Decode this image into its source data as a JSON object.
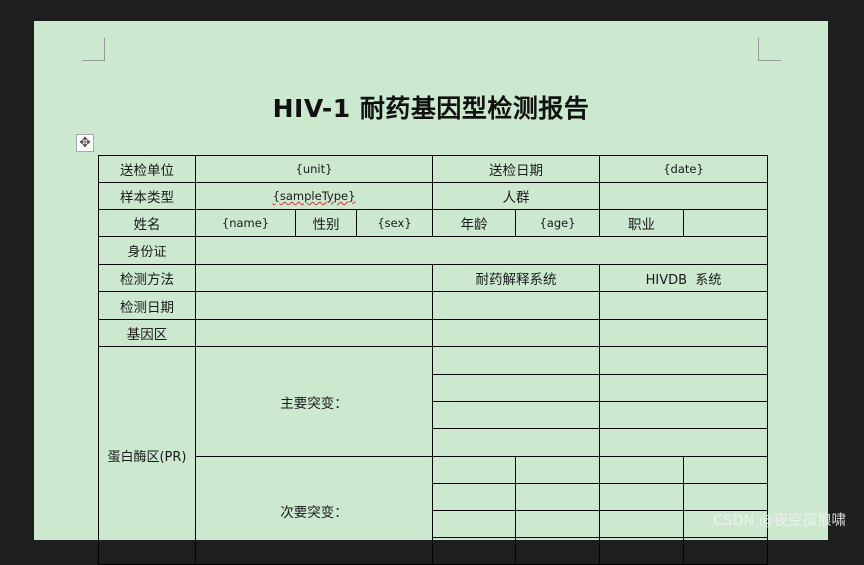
{
  "title": "HIV-1 耐药基因型检测报告",
  "row1": {
    "unit_label": "送检单位",
    "unit_value": "{unit}",
    "date_label": "送检日期",
    "date_value": "{date}"
  },
  "row2": {
    "sample_label": "样本类型",
    "sample_value": "{sampleType}",
    "crowd_label": "人群"
  },
  "row3": {
    "name_label": "姓名",
    "name_value": "{name}",
    "sex_label": "性别",
    "sex_value": "{sex}",
    "age_label": "年龄",
    "age_value": "{age}",
    "job_label": "职业"
  },
  "row4": {
    "id_label": "身份证"
  },
  "row5": {
    "method_label": "检测方法",
    "system_label": "耐药解释系统",
    "system_value": "HIVDB  系统"
  },
  "row6": {
    "test_date_label": "检测日期"
  },
  "row7": {
    "gene_region_label": "基因区"
  },
  "pr": {
    "label": "蛋白酶区(PR)",
    "major_label": "主要突变：",
    "minor_label": "次要突变："
  },
  "watermark": "CSDN @夜空孤狼啸"
}
